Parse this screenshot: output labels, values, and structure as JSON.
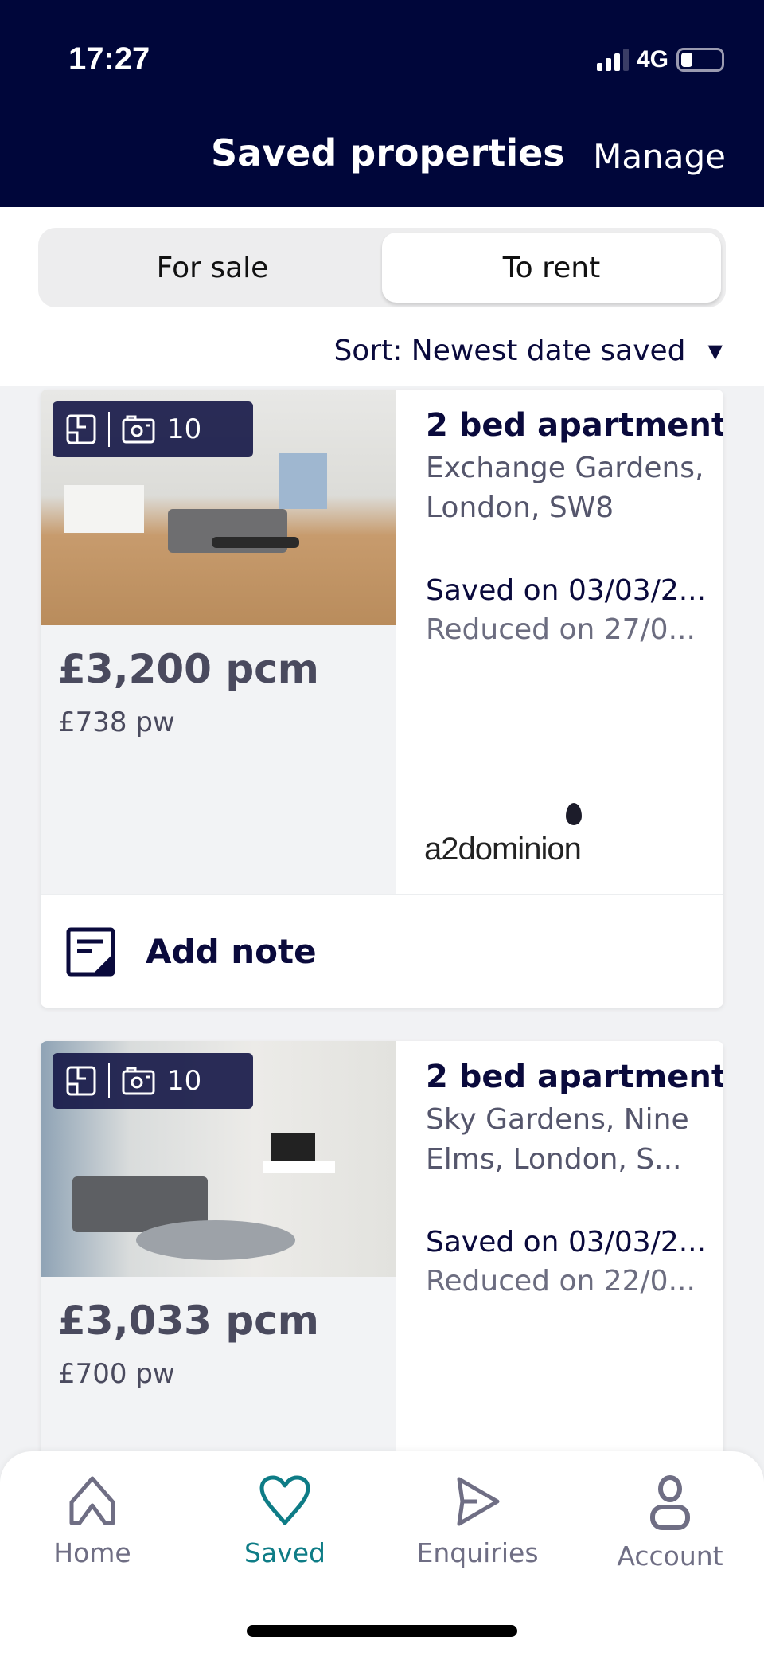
{
  "status_bar": {
    "time": "17:27",
    "network": "4G",
    "signal_bars": 3,
    "battery_level": 0.3
  },
  "header": {
    "title": "Saved properties",
    "manage_label": "Manage"
  },
  "tabs": [
    {
      "label": "For sale",
      "active": false
    },
    {
      "label": "To rent",
      "active": true
    }
  ],
  "sort": {
    "label": "Sort: Newest date saved",
    "icon": "triangle-down-icon"
  },
  "listings": [
    {
      "photo_count": "10",
      "price": "£3,200 pcm",
      "price_weekly": "£738 pw",
      "type": "2 bed apartment",
      "address": "Exchange Gardens, London, SW8",
      "saved": "Saved on 03/03/2...",
      "reduced": "Reduced on 27/0...",
      "agent_logo": "a2dominion",
      "note_label": "Add note"
    },
    {
      "photo_count": "10",
      "price": "£3,033 pcm",
      "price_weekly": "£700 pw",
      "type": "2 bed apartment",
      "address": "Sky Gardens, Nine Elms, London, S...",
      "saved": "Saved on 03/03/2...",
      "reduced": "Reduced on 22/0..."
    }
  ],
  "nav": [
    {
      "label": "Home",
      "icon": "home-icon"
    },
    {
      "label": "Saved",
      "icon": "heart-icon",
      "active": true
    },
    {
      "label": "Enquiries",
      "icon": "send-icon"
    },
    {
      "label": "Account",
      "icon": "person-icon"
    }
  ],
  "colors": {
    "header": "#00063a",
    "accent": "#0e7c86",
    "text": "#0a0a3c"
  }
}
